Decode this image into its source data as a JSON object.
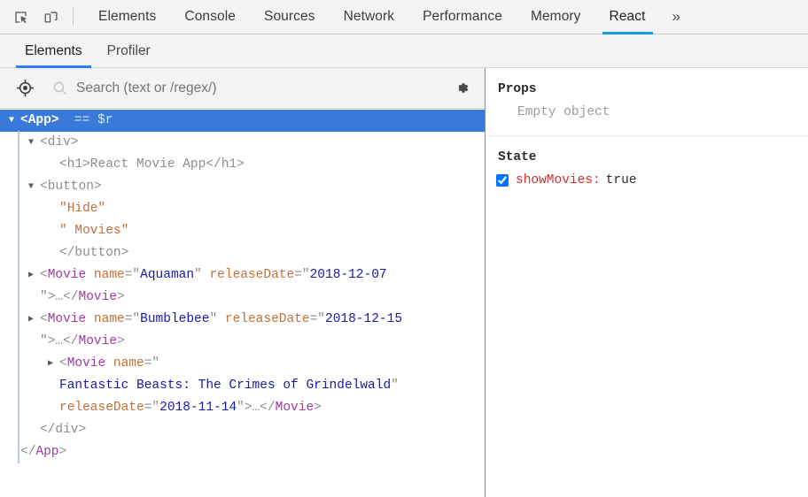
{
  "toolbar": {
    "inspect_icon": "inspect-element-icon",
    "device_icon": "device-toolbar-icon",
    "overflow_label": "»"
  },
  "main_tabs": [
    {
      "label": "Elements",
      "active": false
    },
    {
      "label": "Console",
      "active": false
    },
    {
      "label": "Sources",
      "active": false
    },
    {
      "label": "Network",
      "active": false
    },
    {
      "label": "Performance",
      "active": false
    },
    {
      "label": "Memory",
      "active": false
    },
    {
      "label": "React",
      "active": true
    }
  ],
  "sub_tabs": [
    {
      "label": "Elements",
      "active": true
    },
    {
      "label": "Profiler",
      "active": false
    }
  ],
  "search": {
    "placeholder": "Search (text or /regex/)",
    "value": "",
    "target_icon": "target-crosshair-icon",
    "search_icon": "search-icon",
    "settings_icon": "gear-icon"
  },
  "tree": {
    "rows": [
      {
        "id": "app-open",
        "indent": 0,
        "arrow": "▼",
        "selected": true,
        "tokens": [
          {
            "t": "bracket",
            "v": "<"
          },
          {
            "t": "tag-name",
            "v": "App"
          },
          {
            "t": "bracket",
            "v": ">"
          },
          {
            "t": "dollar-r",
            "v": "  == $r"
          }
        ]
      },
      {
        "id": "div-open",
        "indent": 1,
        "arrow": "▼",
        "selected": false,
        "tokens": [
          {
            "t": "tag-html",
            "v": "<div>"
          }
        ]
      },
      {
        "id": "h1",
        "indent": 2,
        "arrow": "",
        "selected": false,
        "tokens": [
          {
            "t": "tag-html",
            "v": "<h1>React Movie App</h1>"
          }
        ]
      },
      {
        "id": "button-open",
        "indent": 1,
        "arrow": "▼",
        "selected": false,
        "tokens": [
          {
            "t": "tag-html",
            "v": "<button>"
          }
        ]
      },
      {
        "id": "text-hide",
        "indent": 2,
        "arrow": "",
        "selected": false,
        "tokens": [
          {
            "t": "text-node",
            "v": "\"Hide\""
          }
        ]
      },
      {
        "id": "text-movies",
        "indent": 2,
        "arrow": "",
        "selected": false,
        "tokens": [
          {
            "t": "text-node",
            "v": "\" Movies\""
          }
        ]
      },
      {
        "id": "button-close",
        "indent": 2,
        "arrow": "",
        "selected": false,
        "tokens": [
          {
            "t": "tag-html",
            "v": "</button>"
          }
        ]
      },
      {
        "id": "movie-aquaman",
        "indent": 1,
        "arrow": "▶",
        "selected": false,
        "tokens": [
          {
            "t": "bracket",
            "v": "<"
          },
          {
            "t": "tag-name",
            "v": "Movie"
          },
          {
            "t": "attr-name",
            "v": " name"
          },
          {
            "t": "quote",
            "v": "=\""
          },
          {
            "t": "attr-val",
            "v": "Aquaman"
          },
          {
            "t": "quote",
            "v": "\""
          },
          {
            "t": "attr-name",
            "v": " releaseDate"
          },
          {
            "t": "quote",
            "v": "=\""
          },
          {
            "t": "attr-val",
            "v": "2018-12-07"
          }
        ]
      },
      {
        "id": "movie-aquaman-cont",
        "indent": 1,
        "arrow": "",
        "selected": false,
        "tokens": [
          {
            "t": "quote",
            "v": "\""
          },
          {
            "t": "bracket",
            "v": ">"
          },
          {
            "t": "ellipsis",
            "v": "…"
          },
          {
            "t": "bracket",
            "v": "</"
          },
          {
            "t": "tag-name",
            "v": "Movie"
          },
          {
            "t": "bracket",
            "v": ">"
          }
        ]
      },
      {
        "id": "movie-bumblebee",
        "indent": 1,
        "arrow": "▶",
        "selected": false,
        "tokens": [
          {
            "t": "bracket",
            "v": "<"
          },
          {
            "t": "tag-name",
            "v": "Movie"
          },
          {
            "t": "attr-name",
            "v": " name"
          },
          {
            "t": "quote",
            "v": "=\""
          },
          {
            "t": "attr-val",
            "v": "Bumblebee"
          },
          {
            "t": "quote",
            "v": "\""
          },
          {
            "t": "attr-name",
            "v": " releaseDate"
          },
          {
            "t": "quote",
            "v": "=\""
          },
          {
            "t": "attr-val",
            "v": "2018-12-15"
          }
        ]
      },
      {
        "id": "movie-bumblebee-cont",
        "indent": 1,
        "arrow": "",
        "selected": false,
        "tokens": [
          {
            "t": "quote",
            "v": "\""
          },
          {
            "t": "bracket",
            "v": ">"
          },
          {
            "t": "ellipsis",
            "v": "…"
          },
          {
            "t": "bracket",
            "v": "</"
          },
          {
            "t": "tag-name",
            "v": "Movie"
          },
          {
            "t": "bracket",
            "v": ">"
          }
        ]
      },
      {
        "id": "movie-fantastic",
        "indent": 2,
        "arrow": "▶",
        "selected": false,
        "tokens": [
          {
            "t": "bracket",
            "v": "<"
          },
          {
            "t": "tag-name",
            "v": "Movie"
          },
          {
            "t": "attr-name",
            "v": " name"
          },
          {
            "t": "quote",
            "v": "=\""
          }
        ]
      },
      {
        "id": "movie-fantastic-name",
        "indent": 2,
        "arrow": "",
        "selected": false,
        "tokens": [
          {
            "t": "attr-val",
            "v": "Fantastic Beasts: The Crimes of Grindelwald"
          },
          {
            "t": "quote",
            "v": "\""
          }
        ]
      },
      {
        "id": "movie-fantastic-date",
        "indent": 2,
        "arrow": "",
        "selected": false,
        "tokens": [
          {
            "t": "attr-name",
            "v": "releaseDate"
          },
          {
            "t": "quote",
            "v": "=\""
          },
          {
            "t": "attr-val",
            "v": "2018-11-14"
          },
          {
            "t": "quote",
            "v": "\""
          },
          {
            "t": "bracket",
            "v": ">"
          },
          {
            "t": "ellipsis",
            "v": "…"
          },
          {
            "t": "bracket",
            "v": "</"
          },
          {
            "t": "tag-name",
            "v": "Movie"
          },
          {
            "t": "bracket",
            "v": ">"
          }
        ]
      },
      {
        "id": "div-close",
        "indent": 1,
        "arrow": "",
        "selected": false,
        "tokens": [
          {
            "t": "tag-html",
            "v": "</div>"
          }
        ]
      },
      {
        "id": "app-close",
        "indent": 0,
        "arrow": "",
        "selected": false,
        "tokens": [
          {
            "t": "bracket",
            "v": "</"
          },
          {
            "t": "tag-name",
            "v": "App"
          },
          {
            "t": "bracket",
            "v": ">"
          }
        ]
      }
    ]
  },
  "inspector": {
    "props": {
      "title": "Props",
      "empty_text": "Empty object"
    },
    "state": {
      "title": "State",
      "entries": [
        {
          "key": "showMovies",
          "colon": ":",
          "value": "true",
          "checked": true
        }
      ]
    }
  },
  "colors": {
    "selection_blue": "#3879d9",
    "react_tab_underline": "#1a9cdc",
    "sub_tab_underline": "#2d7ff9",
    "component_purple": "#a238a2",
    "attr_orange": "#c2703a",
    "value_blue": "#1a1aa6",
    "state_key_red": "#d42e2e",
    "toolbar_bg": "#f3f3f3"
  }
}
